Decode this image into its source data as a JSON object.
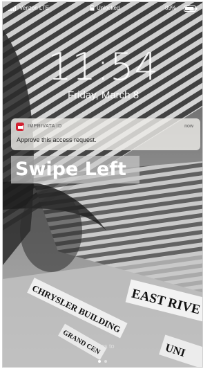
{
  "status_bar": {
    "carrier": "Verizon LTE",
    "lock_state": "Unlocked",
    "battery_percent": "89%",
    "battery_level": 0.89
  },
  "lock_screen": {
    "time": "11:54",
    "date": "Friday, March 8"
  },
  "notification": {
    "app_name": "IMPRIVATA ID",
    "time": "now",
    "message": "Approve this access request.",
    "icon": "imprivata-app-icon",
    "accent_color": "#d02030"
  },
  "overlay_instruction": "Swipe Left",
  "bottom_hint": "press to",
  "wallpaper_signs": {
    "sign_1": "EAST RIVE",
    "sign_2": "CHRYSLER BUILDING",
    "sign_3": "GRAND CEN",
    "sign_4": "UNI"
  }
}
